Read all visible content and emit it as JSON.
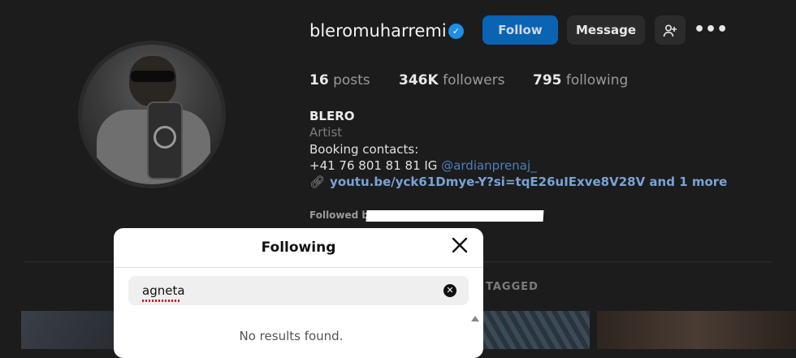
{
  "profile": {
    "username": "bleromuharremi",
    "buttons": {
      "follow": "Follow",
      "message": "Message",
      "add_user_icon": "add-user-icon",
      "more_icon": "more-icon"
    },
    "stats": {
      "posts_count": "16",
      "posts_label": "posts",
      "followers_count": "346K",
      "followers_label": "followers",
      "following_count": "795",
      "following_label": "following"
    },
    "bio": {
      "name": "BLERO",
      "category": "Artist",
      "line1": "Booking contacts:",
      "line2_prefix": "+41 76 801 81 81 IG ",
      "mention": "@ardianprenaj_",
      "link": "youtu.be/yck61Dmye-Y?si=tqE26uIExve8V28V and 1 more",
      "followed_by": "Followed by"
    },
    "tabs": {
      "tagged": "TAGGED"
    }
  },
  "modal": {
    "title": "Following",
    "search_value": "agneta",
    "no_results": "No results found."
  },
  "colors": {
    "accent": "#0a63b3",
    "verified": "#1e8ee6",
    "link": "#7aa3d4"
  }
}
